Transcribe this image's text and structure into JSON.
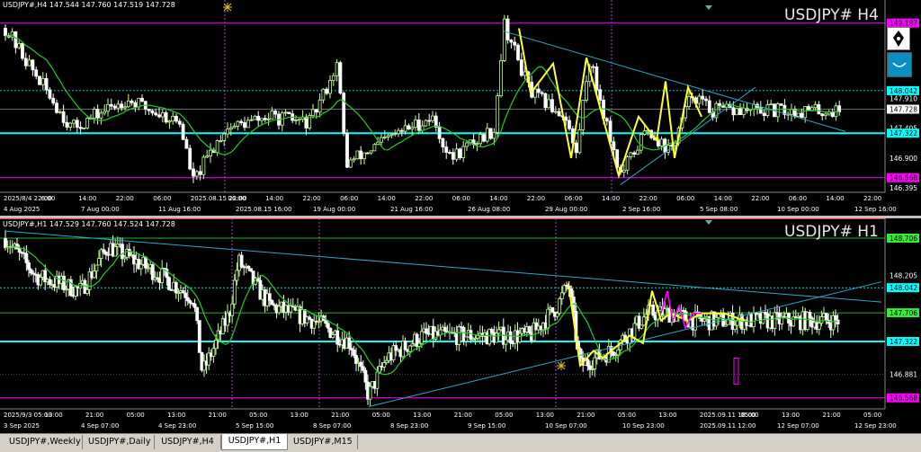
{
  "h4": {
    "header": "USDJPY#,H4  147.544 147.760 147.519 147.728",
    "watermark": "USDJPY# H4",
    "price_labels": [
      {
        "text": "149.187",
        "kind": "magenta-box",
        "price": 149.187
      },
      {
        "text": "148.042",
        "kind": "cyan-box",
        "price": 148.042
      },
      {
        "text": "147.910",
        "kind": "plain",
        "price": 147.91
      },
      {
        "text": "147.728",
        "kind": "white-box",
        "price": 147.728
      },
      {
        "text": "147.405",
        "kind": "plain",
        "price": 147.405
      },
      {
        "text": "147.322",
        "kind": "cyan-box",
        "price": 147.322
      },
      {
        "text": "146.900",
        "kind": "plain",
        "price": 146.9
      },
      {
        "text": "146.568",
        "kind": "magenta-box",
        "price": 146.568
      },
      {
        "text": "146.395",
        "kind": "plain",
        "price": 146.395
      }
    ],
    "time_labels": [
      "2025/8/4 22:00",
      "6:00",
      "14:00",
      "22:00",
      "06:00",
      "2025.08.15 22:00",
      "06:00",
      "14:00",
      "22:00",
      "06:00",
      "14:00",
      "22:00",
      "06:00",
      "14:00",
      "22:00",
      "06:00",
      "14:00",
      "22:00",
      "06:00",
      "14:00",
      "22:00",
      "06:00",
      "14:00",
      "22:00"
    ],
    "date_labels": [
      "4 Aug 2025",
      "7 Aug 00:00",
      "11 Aug 16:00",
      "2025.08.15 16:00",
      "19 Aug 00:00",
      "21 Aug 16:00",
      "26 Aug 08:00",
      "29 Aug 00:00",
      "2 Sep 16:00",
      "5 Sep 08:00",
      "10 Sep 00:00",
      "12 Sep 16:00"
    ]
  },
  "h1": {
    "header": "USDJPY#,H1  147.529 147.760 147.524 147.728",
    "watermark": "USDJPY# H1",
    "price_labels": [
      {
        "text": "148.706",
        "kind": "green-box",
        "price": 148.706
      },
      {
        "text": "148.205",
        "kind": "plain",
        "price": 148.205
      },
      {
        "text": "148.042",
        "kind": "cyan-box",
        "price": 148.042
      },
      {
        "text": "147.706",
        "kind": "green-box",
        "price": 147.706
      },
      {
        "text": "147.322",
        "kind": "cyan-box",
        "price": 147.322
      },
      {
        "text": "146.881",
        "kind": "plain",
        "price": 146.881
      },
      {
        "text": "146.568",
        "kind": "magenta-box",
        "price": 146.568
      }
    ],
    "time_labels": [
      "2025/9/3 05:00",
      "13:00",
      "21:00",
      "05:00",
      "13:00",
      "21:00",
      "05:00",
      "13:00",
      "21:00",
      "05:00",
      "13:00",
      "21:00",
      "05:00",
      "13:00",
      "21:00",
      "05:00",
      "13:00",
      "2025.09.11 18:00",
      "05:00",
      "13:00",
      "21:00",
      "05:00"
    ],
    "date_labels": [
      "3 Sep 2025",
      "4 Sep 07:00",
      "4 Sep 23:00",
      "5 Sep 15:00",
      "8 Sep 07:00",
      "8 Sep 23:00",
      "9 Sep 15:00",
      "10 Sep 07:00",
      "10 Sep 23:00",
      "2025.09.11 12:00",
      "12 Sep 07:00",
      "12 Sep 23:00"
    ]
  },
  "tabs": [
    {
      "label": "USDJPY#,Weekly",
      "active": false
    },
    {
      "label": "USDJPY#,Daily",
      "active": false
    },
    {
      "label": "USDJPY#,H4",
      "active": false
    },
    {
      "label": "USDJPY#,H1",
      "active": true
    },
    {
      "label": "USDJPY#,M15",
      "active": false
    }
  ],
  "colors": {
    "bull": "#c8ff9a",
    "bear": "#ffffff",
    "ma": "#22cc22",
    "hline_cyan": "#00ffff",
    "hline_magenta": "#ff00ff",
    "trend": "#2fa7c8",
    "zigzag": "#ffff33",
    "vline": "#aa44cc"
  },
  "icons": [
    "pen-nib-icon",
    "smile-icon",
    "crosshair-marker-icon"
  ]
}
